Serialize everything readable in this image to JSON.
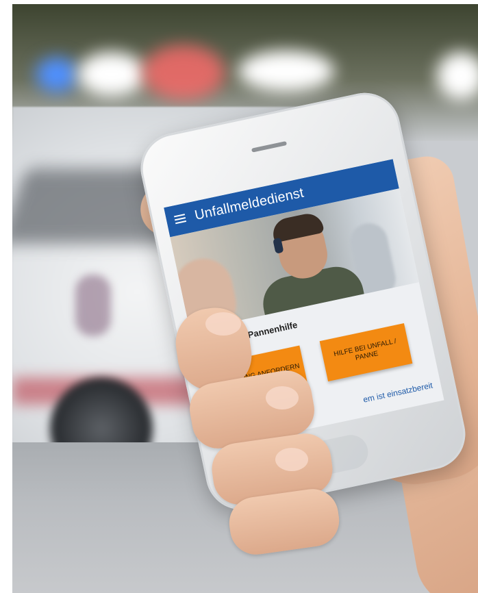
{
  "app": {
    "title": "Unfallmeldedienst",
    "section_title": "Unfall- und Pannenhilfe",
    "buttons": {
      "rescue": "RETTUNG ANFORDERN",
      "help": "HILFE BEI UNFALL / PANNE"
    },
    "status_text": "em ist einsatzbereit"
  },
  "colors": {
    "appbar": "#1e5aa8",
    "button": "#f38a12",
    "status_text": "#1e5aa8"
  },
  "icons": {
    "menu": "hamburger-menu-icon"
  }
}
